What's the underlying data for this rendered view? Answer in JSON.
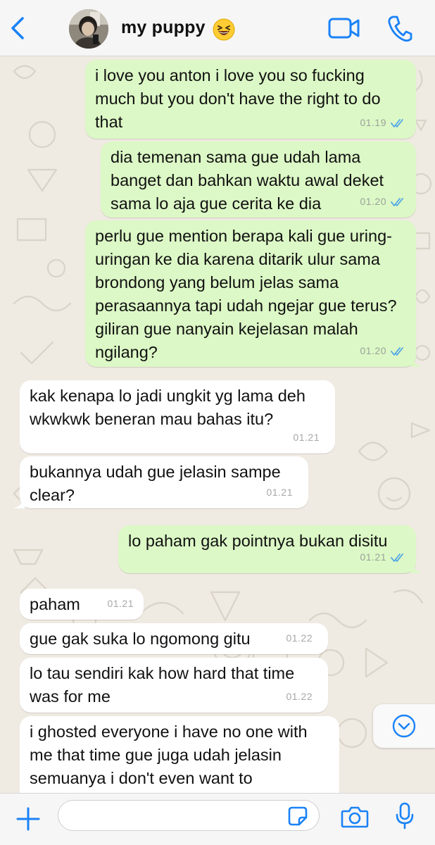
{
  "header": {
    "contact_name": "my puppy",
    "status_emoji": "😆",
    "icons": [
      "chevron-left-icon",
      "video-call-icon",
      "phone-icon"
    ]
  },
  "messages": [
    {
      "direction": "outgoing",
      "text": "i love you anton i love you so fucking much but you don't have the right to do that",
      "time": "01.19",
      "read": true
    },
    {
      "direction": "outgoing",
      "text": "dia temenan sama gue udah lama banget dan bahkan waktu awal deket sama lo aja gue cerita ke dia",
      "time": "01.20",
      "read": true
    },
    {
      "direction": "outgoing",
      "text": "perlu gue mention berapa kali gue uring-uringan ke dia karena ditarik ulur sama brondong yang belum jelas sama perasaannya tapi udah ngejar gue terus? giliran gue nanyain kejelasan malah ngilang?",
      "time": "01.20",
      "read": true
    },
    {
      "direction": "incoming",
      "text": "kak kenapa lo jadi ungkit yg lama deh wkwkwk beneran mau bahas itu?",
      "time": "01.21"
    },
    {
      "direction": "incoming",
      "text": "bukannya udah gue jelasin sampe clear?",
      "time": "01.21"
    },
    {
      "direction": "outgoing",
      "text": "lo paham gak pointnya bukan disitu",
      "time": "01.21",
      "read": true
    },
    {
      "direction": "incoming",
      "text": "paham",
      "time": "01.21"
    },
    {
      "direction": "incoming",
      "text": "gue gak suka lo ngomong gitu",
      "time": "01.22"
    },
    {
      "direction": "incoming",
      "text": "lo tau sendiri kak how hard that time was for me",
      "time": "01.22"
    },
    {
      "direction": "incoming",
      "text": "i ghosted everyone i have no one with me that time gue juga udah jelasin semuanya i don't even want to",
      "time": ""
    }
  ],
  "composer": {
    "placeholder": "",
    "icons": [
      "plus-icon",
      "sticker-icon",
      "camera-icon",
      "microphone-icon"
    ]
  },
  "colors": {
    "accent": "#1a82f7",
    "outgoing_bubble": "#dcf8c6",
    "incoming_bubble": "#ffffff",
    "chat_background": "#efeae2",
    "read_ticks": "#4fa6e8"
  }
}
